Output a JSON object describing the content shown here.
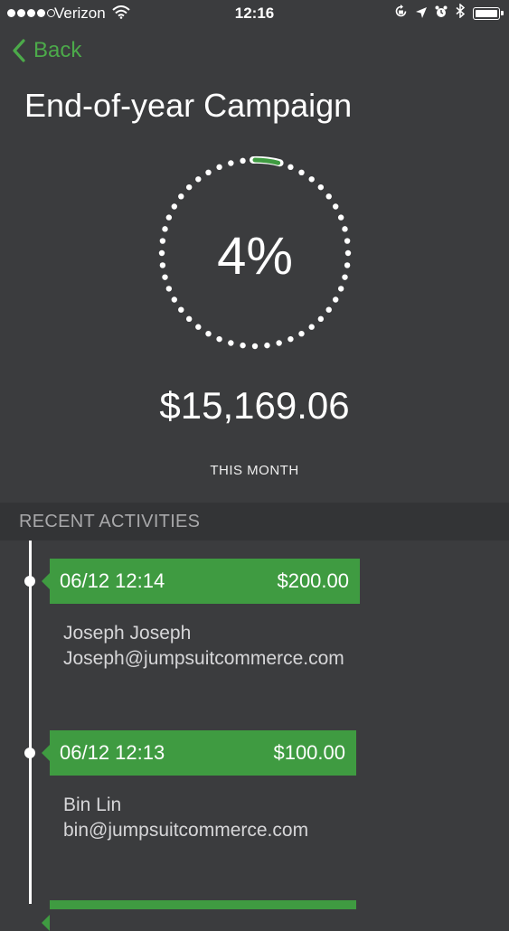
{
  "status_bar": {
    "carrier": "Verizon",
    "time": "12:16",
    "signal_filled": 4,
    "signal_total": 5,
    "icons": [
      "wifi-icon",
      "rotation-lock-icon",
      "location-arrow-icon",
      "alarm-clock-icon",
      "bluetooth-icon",
      "battery-icon"
    ]
  },
  "nav": {
    "back_label": "Back"
  },
  "campaign": {
    "title": "End-of-year Campaign",
    "progress_percent": "4%",
    "progress_fraction": 0.04,
    "amount": "$15,169.06",
    "period_label": "THIS MONTH"
  },
  "recent": {
    "header": "RECENT ACTIVITIES",
    "items": [
      {
        "datetime": "06/12 12:14",
        "amount": "$200.00",
        "name": "Joseph Joseph",
        "email": "Joseph@jumpsuitcommerce.com"
      },
      {
        "datetime": "06/12 12:13",
        "amount": "$100.00",
        "name": "Bin Lin",
        "email": "bin@jumpsuitcommerce.com"
      }
    ]
  },
  "colors": {
    "accent": "#3f9b41",
    "back_link": "#4caa4a",
    "background": "#3b3c3e",
    "section_bg": "#333436"
  }
}
